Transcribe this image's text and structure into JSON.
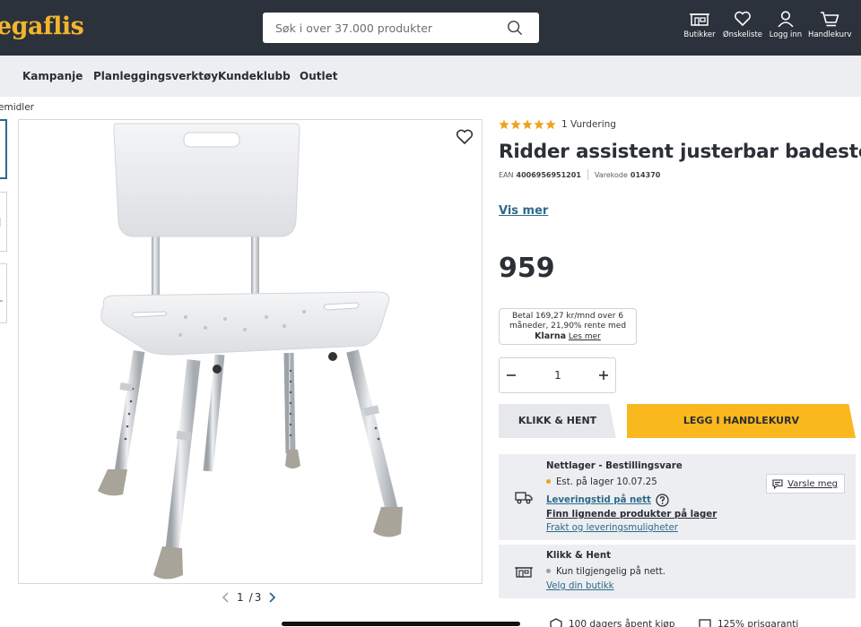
{
  "header": {
    "logo": "egaflis",
    "search": {
      "placeholder": "Søk i over 37.000 produkter"
    },
    "icons": [
      {
        "label": "Butikker",
        "icon": "store-icon"
      },
      {
        "label": "Ønskeliste",
        "icon": "heart-icon"
      },
      {
        "label": "Logg inn",
        "icon": "user-icon"
      },
      {
        "label": "Handlekurv",
        "icon": "cart-icon"
      }
    ]
  },
  "nav": {
    "items": [
      "Kampanje",
      "Planleggingsverktøy",
      "Kundeklubb",
      "Outlet"
    ]
  },
  "breadcrumb": "emidler",
  "gallery": {
    "current": "1",
    "separator": "/",
    "total": "3"
  },
  "product": {
    "rating_text": "1 Vurdering",
    "rating": 5,
    "title": "Ridder assistent justerbar badestol",
    "ean_label": "EAN",
    "ean": "4006956951201",
    "code_label": "Varekode",
    "code": "014370",
    "vis_mer": "Vis mer",
    "price": "959",
    "klarna": {
      "line1": "Betal 169,27 kr/mnd over 6",
      "line2": "måneder, 21,90% rente med",
      "brand": "Klarna",
      "link": "Les mer"
    },
    "quantity": "1"
  },
  "actions": {
    "klikk_hent": "KLIKK & HENT",
    "legg_i_handlekurv": "LEGG I HANDLEKURV"
  },
  "stock_online": {
    "title": "Nettlager - Bestillingsvare",
    "status": "Est. på lager 10.07.25",
    "status_color": "#f0a21d",
    "delivery_link": "Leveringstid på nett",
    "similar_link": "Finn lignende produkter på lager",
    "shipping_link": "Frakt og leveringsmuligheter",
    "notify_button": "Varsle meg"
  },
  "stock_store": {
    "title": "Klikk & Hent",
    "status": "Kun tilgjengelig på nett.",
    "status_color": "#9aa0a6",
    "store_link": "Velg din butikk"
  },
  "bottom": {
    "text1": "100 dagers åpent kjøp",
    "text2": "125% prisgaranti"
  },
  "colors": {
    "header_bg": "#2c323b",
    "accent": "#f8b81e",
    "link": "#2d6a8a"
  }
}
